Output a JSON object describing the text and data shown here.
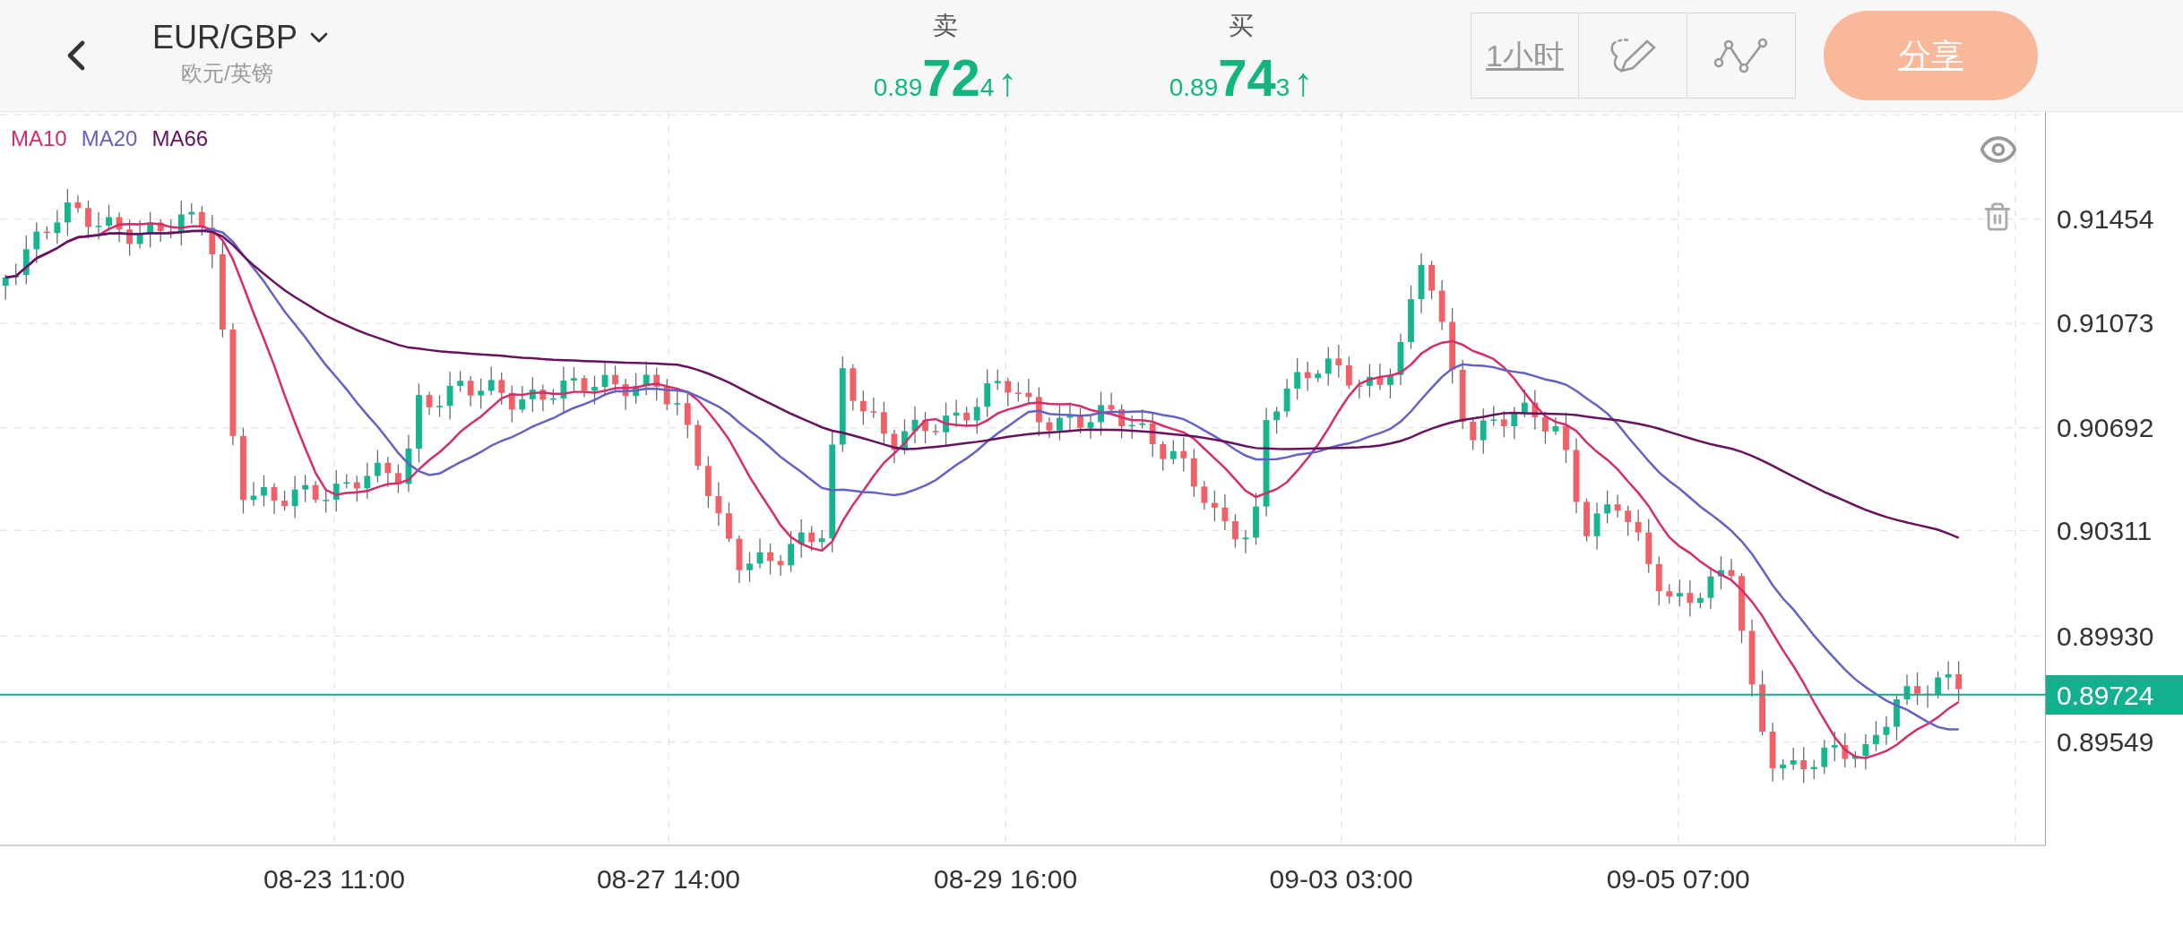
{
  "symbol": {
    "title": "EUR/GBP",
    "subtitle": "欧元/英镑"
  },
  "quotes": [
    {
      "label": "卖",
      "price_prefix": "0.89",
      "price_big": "72",
      "price_small": "4",
      "arrow": "↑"
    },
    {
      "label": "买",
      "price_prefix": "0.89",
      "price_big": "74",
      "price_small": "3",
      "arrow": "↑"
    }
  ],
  "toolbar": {
    "interval": "1小时",
    "share": "分享"
  },
  "chart": {
    "legend": [
      {
        "label": "MA10",
        "color": "#d42c6c"
      },
      {
        "label": "MA20",
        "color": "#6461c4"
      },
      {
        "label": "MA66",
        "color": "#66125e"
      }
    ],
    "y_labels": [
      "0.91454",
      "0.91073",
      "0.90692",
      "0.90311",
      "0.89930",
      "0.89549"
    ],
    "current_price": "0.89724",
    "x_labels": [
      "08-23 11:00",
      "08-27 14:00",
      "08-29 16:00",
      "09-03 03:00",
      "09-05 07:00"
    ]
  }
}
